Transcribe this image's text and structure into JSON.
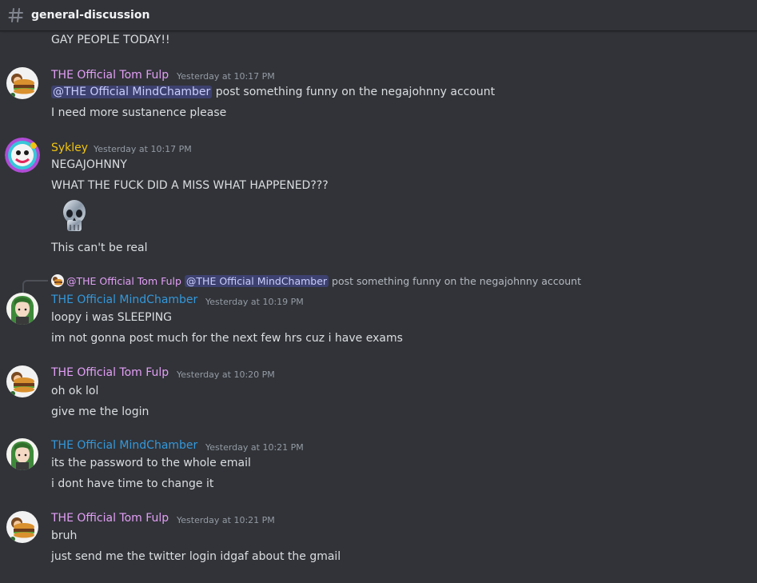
{
  "channel": {
    "name": "general-discussion",
    "icon": "hash-icon"
  },
  "colors": {
    "background": "#313338",
    "tom_fulp": "#e39ff6",
    "sykley": "#f1c40f",
    "mindchamber": "#3498db",
    "mention_bg": "#3c4270",
    "mention_text": "#c9cdfb"
  },
  "messages": [
    {
      "id": "m0",
      "lines": [
        "GAY PEOPLE TODAY!!"
      ]
    },
    {
      "id": "m1",
      "author": "THE Official Tom Fulp",
      "timestamp": "Yesterday at 10:17 PM",
      "avatar": "burger-avatar",
      "mention": "@THE Official MindChamber",
      "line1_rest": " post something funny on the negajohnny account",
      "line2": "I need more sustanence please"
    },
    {
      "id": "m2",
      "author": "Sykley",
      "timestamp": "Yesterday at 10:17 PM",
      "avatar": "clown-avatar",
      "line1": "NEGAJOHNNY",
      "line2": "WHAT THE FUCK DID A MISS WHAT HAPPENED???",
      "emoji": "skull-emoji",
      "line3": "This can't be real"
    },
    {
      "id": "m3",
      "reply": {
        "author": "@THE Official Tom Fulp",
        "mention": "@THE Official MindChamber",
        "text": " post something funny on the negajohnny account"
      },
      "author": "THE Official MindChamber",
      "timestamp": "Yesterday at 10:19 PM",
      "avatar": "green-hair-avatar",
      "line1": "loopy i was SLEEPING",
      "line2": "im not gonna post much for the next few hrs cuz i have exams"
    },
    {
      "id": "m4",
      "author": "THE Official Tom Fulp",
      "timestamp": "Yesterday at 10:20 PM",
      "avatar": "burger-avatar",
      "line1": "oh ok lol",
      "line2": "give me the login"
    },
    {
      "id": "m5",
      "author": "THE Official MindChamber",
      "timestamp": "Yesterday at 10:21 PM",
      "avatar": "green-hair-avatar",
      "line1": "its the password to the whole email",
      "line2": "i dont have time to change it"
    },
    {
      "id": "m6",
      "author": "THE Official Tom Fulp",
      "timestamp": "Yesterday at 10:21 PM",
      "avatar": "burger-avatar",
      "line1": "bruh",
      "line2": "just send me the twitter login idgaf about the gmail"
    }
  ]
}
